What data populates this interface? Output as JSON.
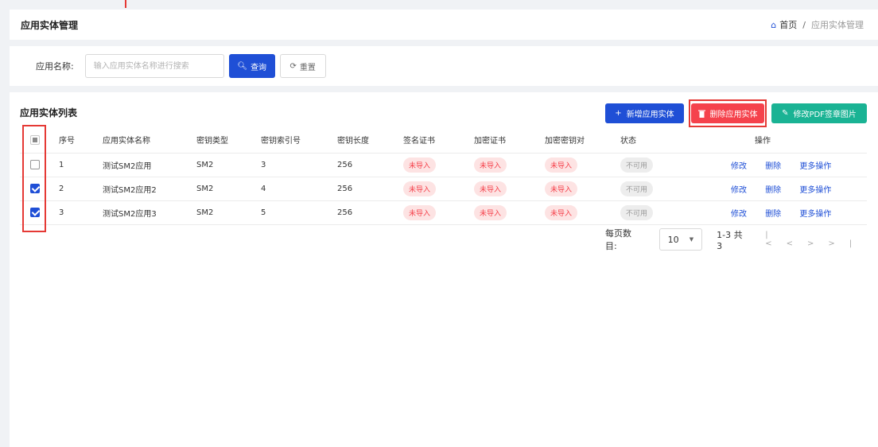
{
  "header": {
    "title": "应用实体管理"
  },
  "breadcrumb": {
    "home": "首页",
    "separator": "/",
    "current": "应用实体管理"
  },
  "search": {
    "label": "应用名称:",
    "placeholder": "输入应用实体名称进行搜索",
    "value": "",
    "search_label": "查询",
    "reset_label": "重置"
  },
  "list": {
    "title": "应用实体列表",
    "buttons": {
      "add": "新增应用实体",
      "delete": "删除应用实体",
      "pdf": "修改PDF签章图片"
    },
    "columns": [
      "序号",
      "应用实体名称",
      "密钥类型",
      "密钥索引号",
      "密钥长度",
      "签名证书",
      "加密证书",
      "加密密钥对",
      "状态",
      "操作"
    ],
    "rows": [
      {
        "checked": false,
        "no": "1",
        "name": "测试SM2应用",
        "type": "SM2",
        "index": "3",
        "length": "256",
        "sign_cert": "未导入",
        "enc_cert": "未导入",
        "enc_key": "未导入",
        "status": "不可用",
        "actions": [
          "修改",
          "删除",
          "更多操作"
        ]
      },
      {
        "checked": true,
        "no": "2",
        "name": "测试SM2应用2",
        "type": "SM2",
        "index": "4",
        "length": "256",
        "sign_cert": "未导入",
        "enc_cert": "未导入",
        "enc_key": "未导入",
        "status": "不可用",
        "actions": [
          "修改",
          "删除",
          "更多操作"
        ]
      },
      {
        "checked": true,
        "no": "3",
        "name": "测试SM2应用3",
        "type": "SM2",
        "index": "5",
        "length": "256",
        "sign_cert": "未导入",
        "enc_cert": "未导入",
        "enc_key": "未导入",
        "status": "不可用",
        "actions": [
          "修改",
          "删除",
          "更多操作"
        ]
      }
    ]
  },
  "pagination": {
    "page_size_label": "每页数目:",
    "page_size": "10",
    "range": "1-3 共 3"
  },
  "icons": {
    "home": "home-icon",
    "search": "search-icon",
    "reset": "refresh-icon",
    "add": "plus-icon",
    "delete": "trash-icon",
    "pdf": "pencil-icon",
    "dropdown": "chevron-down-icon",
    "nav": [
      "first-page-icon",
      "prev-page-icon",
      "next-page-icon",
      "last-page-icon"
    ]
  },
  "colors": {
    "primary": "#1f4fd6",
    "danger": "#f5424c",
    "success": "#1ab394",
    "highlight": "#e53935"
  }
}
